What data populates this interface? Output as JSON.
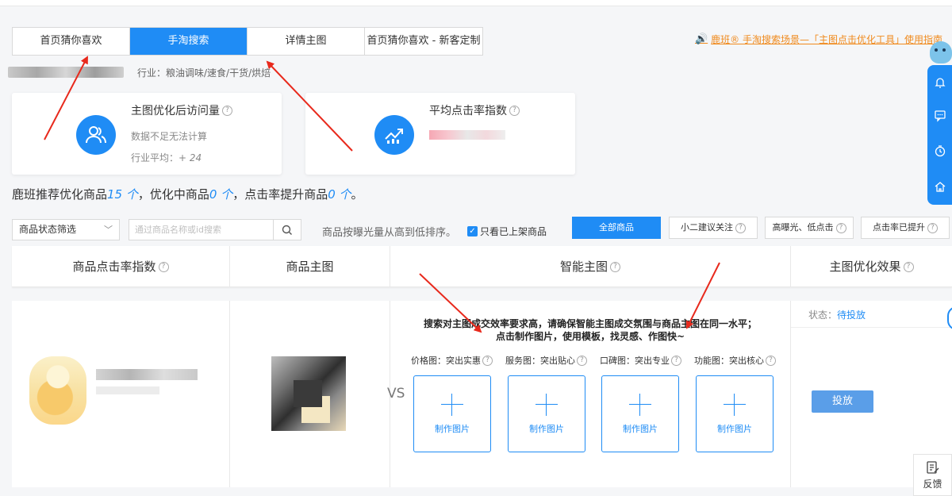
{
  "tabs": [
    {
      "label": "首页猜你喜欢",
      "active": false
    },
    {
      "label": "手淘搜索",
      "active": true
    },
    {
      "label": "详情主图",
      "active": false
    },
    {
      "label": "首页猜你喜欢 - 新客定制",
      "active": false
    }
  ],
  "guide_link": "鹿班® 手淘搜索场景—「主图点击优化工具」使用指南",
  "industry": "行业：粮油调味/速食/干货/烘焙",
  "cards": [
    {
      "title": "主图优化后访问量",
      "sub": "数据不足无法计算",
      "avg_label": "行业平均：",
      "avg_value": "+ 24"
    },
    {
      "title": "平均点击率指数"
    }
  ],
  "summary": {
    "part1": "鹿班推荐优化商品",
    "n1": "15 个",
    "part2": "，优化中商品",
    "n2": "0 个",
    "part3": "，点击率提升商品",
    "n3": "0 个",
    "end": "。"
  },
  "filter": {
    "status_select": "商品状态筛选",
    "search_placeholder": "通过商品名称或id搜索",
    "sort_text": "商品按曝光量从高到低排序。",
    "only_listed": "只看已上架商品"
  },
  "filter_buttons": [
    "全部商品",
    "小二建议关注",
    "高曝光、低点击",
    "点击率已提升"
  ],
  "table": {
    "headers": [
      "商品点击率指数",
      "商品主图",
      "智能主图",
      "主图优化效果"
    ],
    "vs": "VS",
    "smart_line1": "搜索对主图成交效率要求高，请确保智能主图成交氛围与商品主图在同一水平；",
    "smart_line2": "点击制作图片，使用模板，找灵感、作图快~",
    "slots": [
      {
        "label": "价格图：突出实惠",
        "action": "制作图片"
      },
      {
        "label": "服务图：突出贴心",
        "action": "制作图片"
      },
      {
        "label": "口碑图：突出专业",
        "action": "制作图片"
      },
      {
        "label": "功能图：突出核心",
        "action": "制作图片"
      }
    ],
    "status_label": "状态：",
    "status_value": "待投放",
    "launch_button": "投放"
  },
  "feedback": "反馈",
  "colors": {
    "primary": "#1f8cf5",
    "orange": "#f08a1d",
    "arrow": "#e8291c"
  }
}
